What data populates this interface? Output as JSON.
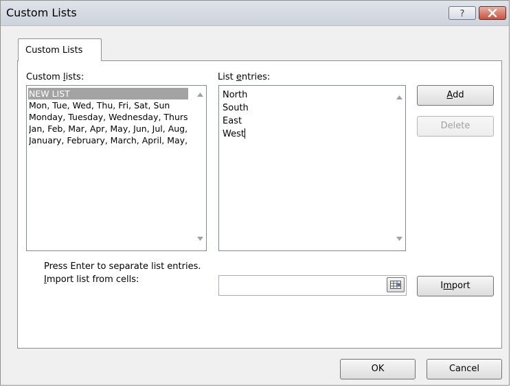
{
  "window": {
    "title": "Custom Lists",
    "help_glyph": "?",
    "close_glyph": "×"
  },
  "tab": {
    "label": "Custom Lists"
  },
  "custom_lists": {
    "label_pre": "Custom ",
    "label_key": "l",
    "label_post": "ists:",
    "items": [
      "NEW LIST",
      "Mon, Tue, Wed, Thu, Fri, Sat, Sun",
      "Monday, Tuesday, Wednesday, Thursday, Friday, Saturday, Sunday",
      "Jan, Feb, Mar, Apr, May, Jun, Jul, Aug, Sep, Oct, Nov, Dec",
      "January, February, March, April, May, June, July, August, September, October, November, December"
    ],
    "selected_index": 0
  },
  "list_entries": {
    "label_pre": "List ",
    "label_key": "e",
    "label_post": "ntries:",
    "lines": [
      "North",
      "South",
      "East",
      "West"
    ]
  },
  "buttons": {
    "add_key": "A",
    "add_rest": "dd",
    "delete": "Delete",
    "import_pre": "I",
    "import_key": "m",
    "import_post": "port",
    "ok": "OK",
    "cancel": "Cancel"
  },
  "hint": "Press Enter to separate list entries.",
  "import_field": {
    "label_key": "I",
    "label_rest": "mport list from cells:",
    "value": ""
  }
}
